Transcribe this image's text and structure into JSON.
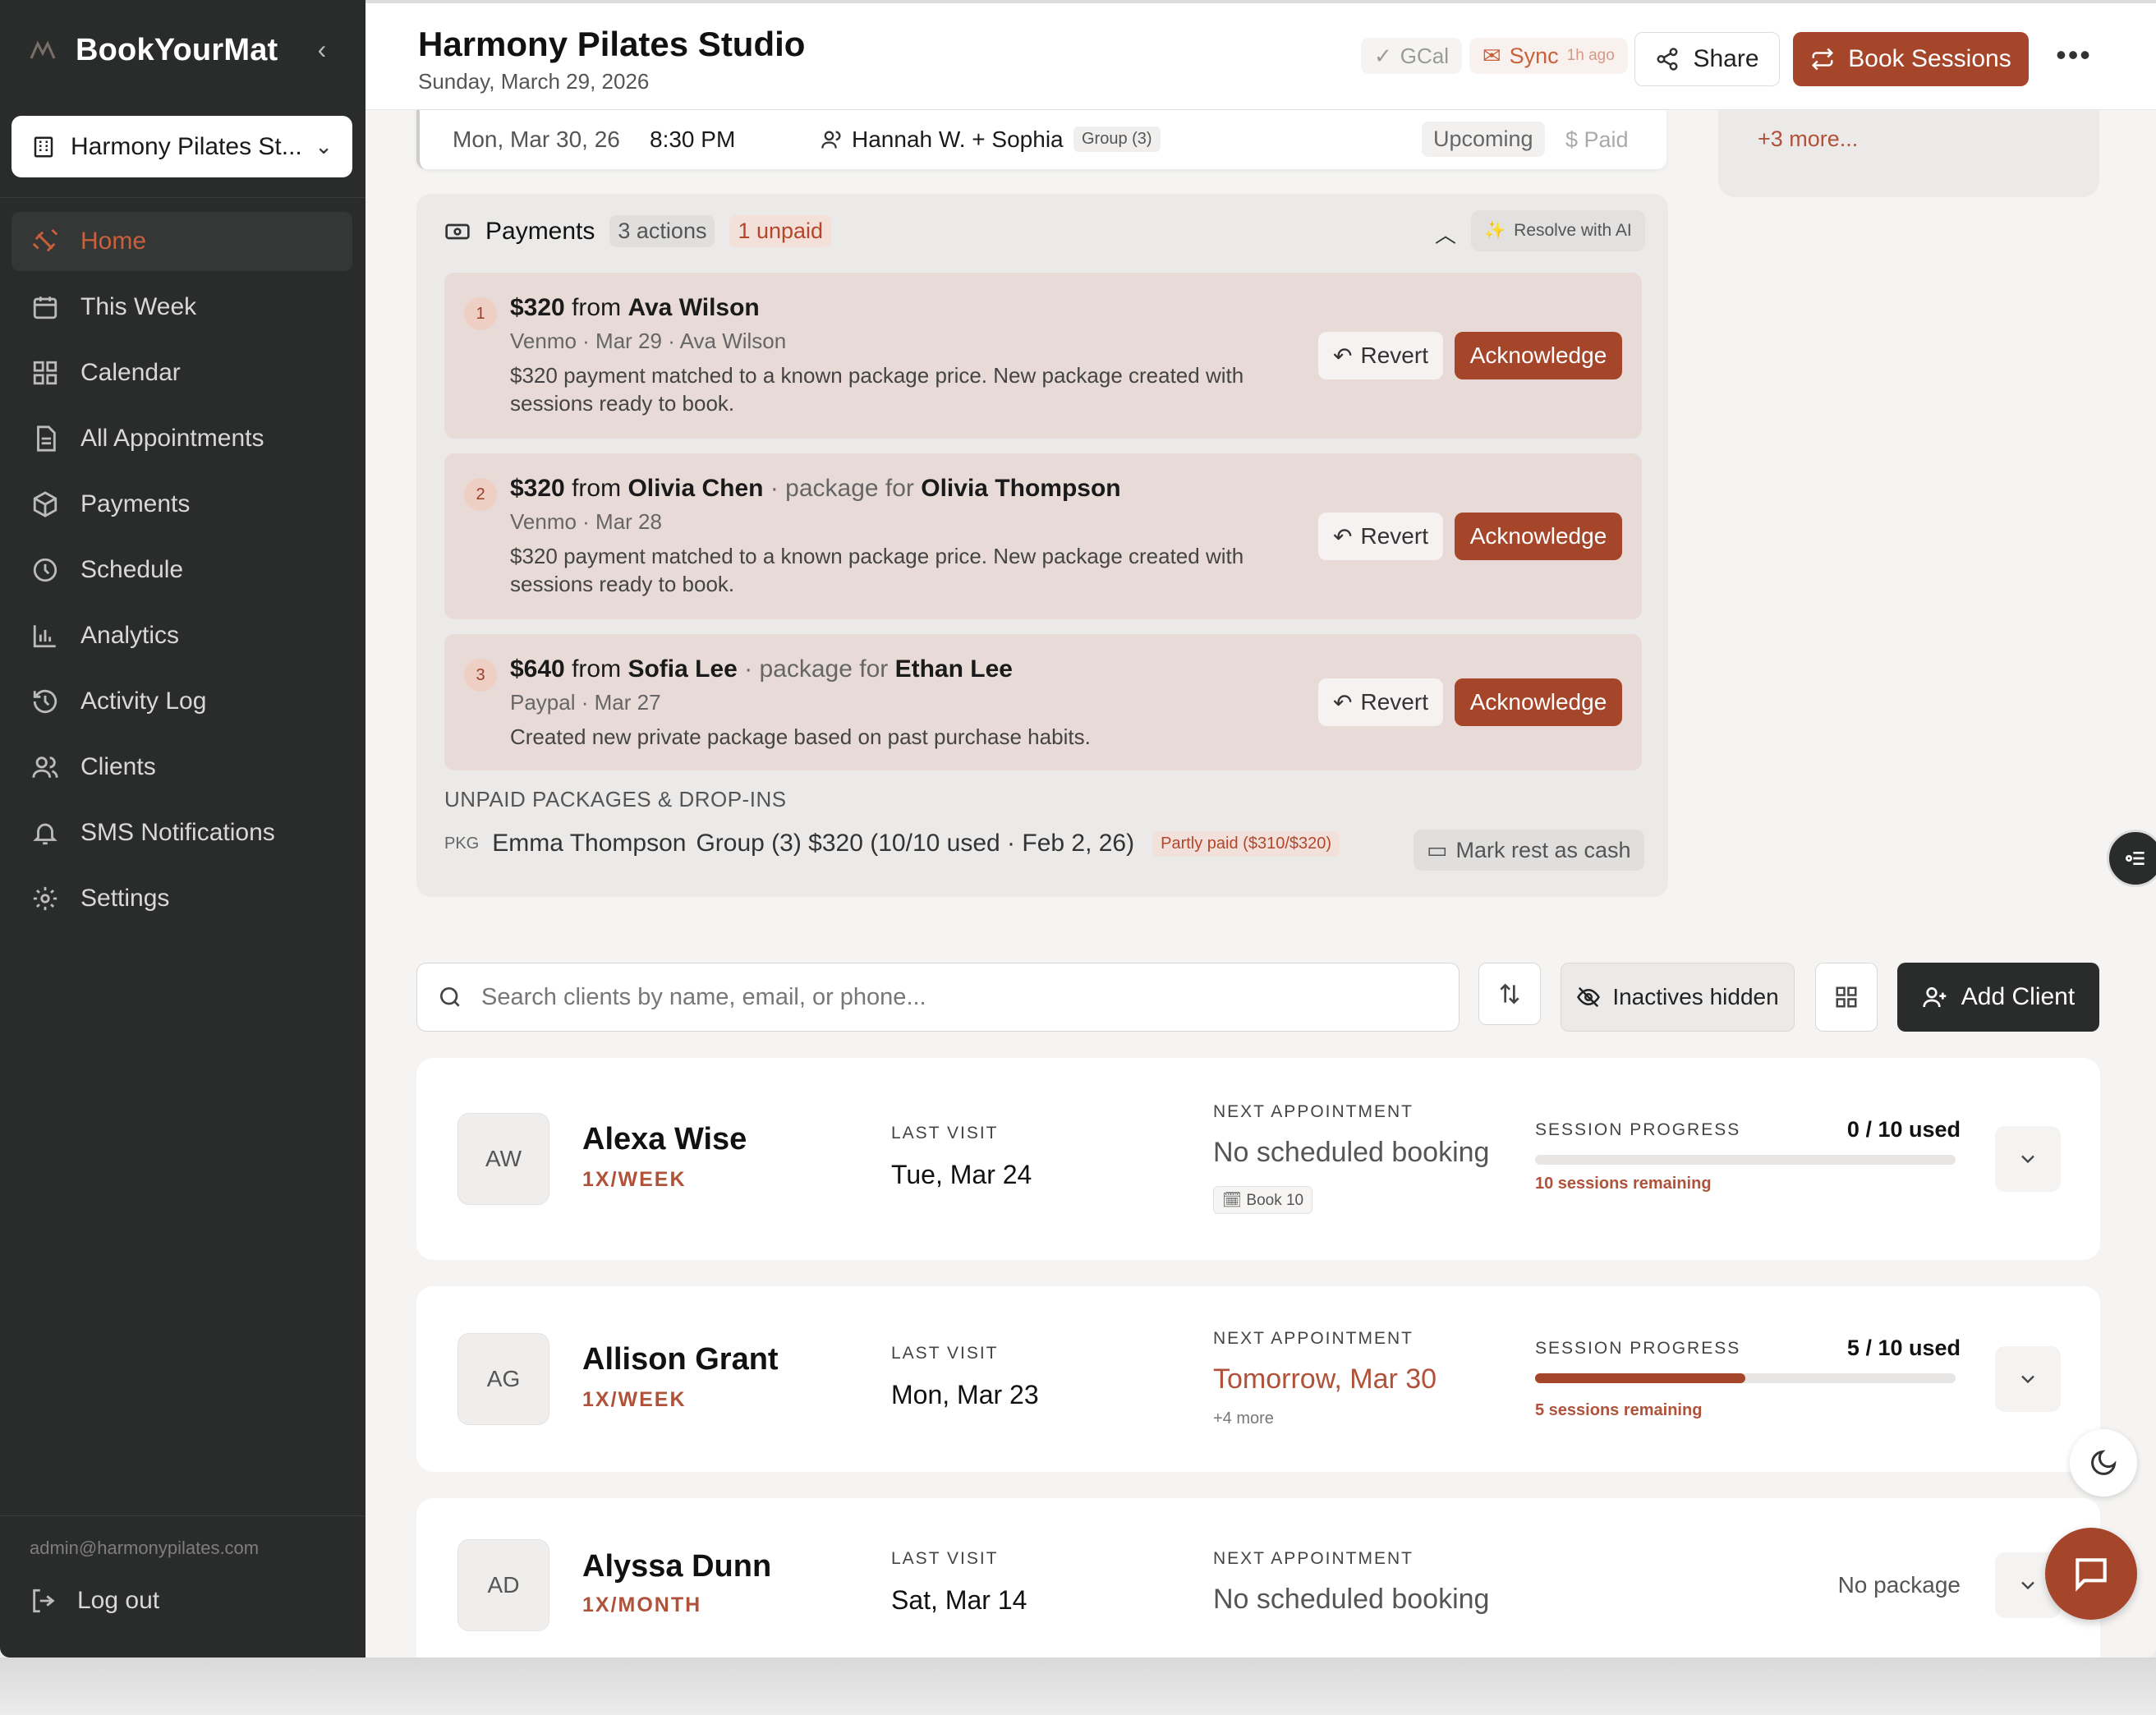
{
  "sidebar": {
    "brand": "BookYourMat",
    "studio_selector": "Harmony Pilates St...",
    "nav": [
      {
        "label": "Home",
        "icon": "dumbbell-icon"
      },
      {
        "label": "This Week",
        "icon": "calendar-week-icon"
      },
      {
        "label": "Calendar",
        "icon": "grid-icon"
      },
      {
        "label": "All Appointments",
        "icon": "document-icon"
      },
      {
        "label": "Payments",
        "icon": "package-icon"
      },
      {
        "label": "Schedule",
        "icon": "clock-icon"
      },
      {
        "label": "Analytics",
        "icon": "bar-chart-icon"
      },
      {
        "label": "Activity Log",
        "icon": "history-icon"
      },
      {
        "label": "Clients",
        "icon": "users-icon"
      },
      {
        "label": "SMS Notifications",
        "icon": "bell-icon"
      },
      {
        "label": "Settings",
        "icon": "gear-icon"
      }
    ],
    "active_index": 0,
    "admin_email": "admin@harmonypilates.com",
    "logout": "Log out"
  },
  "header": {
    "title": "Harmony Pilates Studio",
    "date": "Sunday, March 29, 2026",
    "gcal": "GCal",
    "sync": "Sync",
    "sync_ago": "1h ago",
    "share": "Share",
    "book_sessions": "Book Sessions"
  },
  "appointment": {
    "date": "Mon, Mar 30, 26",
    "time": "8:30 PM",
    "client": "Hannah W. + Sophia",
    "group": "Group (3)",
    "status": "Upcoming",
    "paid": "Paid"
  },
  "right_card": {
    "more": "+3 more..."
  },
  "payments": {
    "title": "Payments",
    "actions_badge": "3 actions",
    "unpaid_badge": "1 unpaid",
    "resolve_ai": "Resolve with AI",
    "revert_label": "Revert",
    "ack_label": "Acknowledge",
    "items": [
      {
        "num": "1",
        "amount": "$320",
        "from_word": "from",
        "payer": "Ava Wilson",
        "pkg_word": "",
        "pkg_for": "",
        "meta": "Venmo · Mar 29 · Ava Wilson",
        "desc": "$320 payment matched to a known package price. New package created with sessions ready to book."
      },
      {
        "num": "2",
        "amount": "$320",
        "from_word": "from",
        "payer": "Olivia Chen",
        "pkg_word": "· package for",
        "pkg_for": "Olivia Thompson",
        "meta": "Venmo · Mar 28",
        "desc": "$320 payment matched to a known package price. New package created with sessions ready to book."
      },
      {
        "num": "3",
        "amount": "$640",
        "from_word": "from",
        "payer": "Sofia Lee",
        "pkg_word": "· package for",
        "pkg_for": "Ethan Lee",
        "meta": "Paypal · Mar 27",
        "desc": "Created new private package based on past purchase habits."
      }
    ],
    "unpaid_heading": "UNPAID PACKAGES & DROP-INS",
    "unpaid_row": {
      "tag": "PKG",
      "name": "Emma Thompson",
      "detail": "Group (3) $320 (10/10 used · Feb 2, 26)",
      "partly": "Partly paid ($310/$320)",
      "mark_cash": "Mark rest as cash"
    }
  },
  "toolbar": {
    "search_placeholder": "Search clients by name, email, or phone...",
    "inactives": "Inactives hidden",
    "add_client": "Add Client"
  },
  "labels": {
    "last_visit": "LAST VISIT",
    "next_appointment": "NEXT APPOINTMENT",
    "session_progress": "SESSION PROGRESS"
  },
  "clients": [
    {
      "initials": "AW",
      "name": "Alexa Wise",
      "freq": "1X/WEEK",
      "last_visit": "Tue, Mar 24",
      "next": "No scheduled booking",
      "next_sub": "Book 10",
      "used": "0 / 10 used",
      "progress": 0.0,
      "remaining": "10 sessions remaining"
    },
    {
      "initials": "AG",
      "name": "Allison Grant",
      "freq": "1X/WEEK",
      "last_visit": "Mon, Mar 23",
      "next": "Tomorrow, Mar 30",
      "next_sub": "+4 more",
      "used": "5 / 10 used",
      "progress": 0.5,
      "remaining": "5 sessions remaining"
    },
    {
      "initials": "AD",
      "name": "Alyssa Dunn",
      "freq": "1X/MONTH",
      "last_visit": "Sat, Mar 14",
      "next": "No scheduled booking",
      "no_package": "No package"
    }
  ],
  "colors": {
    "accent": "#a5452a",
    "sidebar": "#2a2b2b",
    "active_nav": "#c8603c"
  }
}
